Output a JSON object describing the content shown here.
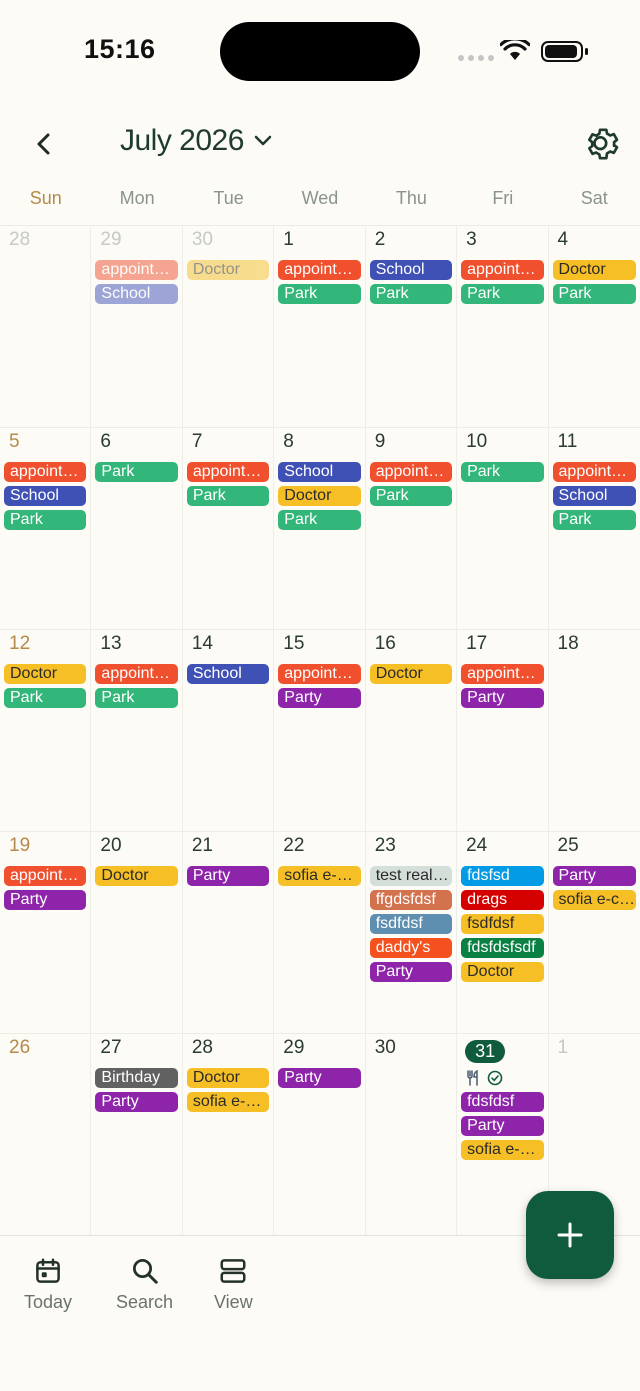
{
  "status_bar": {
    "time": "15:16"
  },
  "header": {
    "title": "July 2026"
  },
  "weekdays": [
    "Sun",
    "Mon",
    "Tue",
    "Wed",
    "Thu",
    "Fri",
    "Sat"
  ],
  "colors": {
    "appointment": "#f0502e",
    "school": "#3f51b5",
    "park": "#33b679",
    "doctor": "#f6bf26",
    "party": "#8e24aa",
    "birthday": "#616161",
    "test": "#d5dfd9",
    "ffgd": "#d2734e",
    "fsdf": "#5e8fb0",
    "daddy": "#f4511e",
    "fdsfsd": "#039be5",
    "drags": "#d50000",
    "fdsfsf": "#0b8043",
    "today": "#0f5b3b"
  },
  "weeks": [
    [
      {
        "day": "28",
        "out": true,
        "events": []
      },
      {
        "day": "29",
        "out": true,
        "events": [
          {
            "label": "appointment",
            "c": "appointment",
            "faded": true
          },
          {
            "label": "School",
            "c": "school",
            "faded": true
          }
        ]
      },
      {
        "day": "30",
        "out": true,
        "events": [
          {
            "label": "Doctor",
            "c": "doctor",
            "faded": true,
            "dark": true
          }
        ]
      },
      {
        "day": "1",
        "events": [
          {
            "label": "appointment",
            "c": "appointment"
          },
          {
            "label": "Park",
            "c": "park"
          }
        ]
      },
      {
        "day": "2",
        "events": [
          {
            "label": "School",
            "c": "school"
          },
          {
            "label": "Park",
            "c": "park"
          }
        ]
      },
      {
        "day": "3",
        "events": [
          {
            "label": "appointment",
            "c": "appointment"
          },
          {
            "label": "Park",
            "c": "park"
          }
        ]
      },
      {
        "day": "4",
        "events": [
          {
            "label": "Doctor",
            "c": "doctor",
            "dark": true
          },
          {
            "label": "Park",
            "c": "park"
          }
        ]
      }
    ],
    [
      {
        "day": "5",
        "sun": true,
        "events": [
          {
            "label": "appointment",
            "c": "appointment"
          },
          {
            "label": "School",
            "c": "school"
          },
          {
            "label": "Park",
            "c": "park"
          }
        ]
      },
      {
        "day": "6",
        "events": [
          {
            "label": "Park",
            "c": "park"
          }
        ]
      },
      {
        "day": "7",
        "events": [
          {
            "label": "appointment",
            "c": "appointment"
          },
          {
            "label": "Park",
            "c": "park"
          }
        ]
      },
      {
        "day": "8",
        "events": [
          {
            "label": "School",
            "c": "school"
          },
          {
            "label": "Doctor",
            "c": "doctor",
            "dark": true
          },
          {
            "label": "Park",
            "c": "park"
          }
        ]
      },
      {
        "day": "9",
        "events": [
          {
            "label": "appointment",
            "c": "appointment"
          },
          {
            "label": "Park",
            "c": "park"
          }
        ]
      },
      {
        "day": "10",
        "events": [
          {
            "label": "Park",
            "c": "park"
          }
        ]
      },
      {
        "day": "11",
        "events": [
          {
            "label": "appointment",
            "c": "appointment"
          },
          {
            "label": "School",
            "c": "school"
          },
          {
            "label": "Park",
            "c": "park"
          }
        ]
      }
    ],
    [
      {
        "day": "12",
        "sun": true,
        "events": [
          {
            "label": "Doctor",
            "c": "doctor",
            "dark": true
          },
          {
            "label": "Park",
            "c": "park"
          }
        ]
      },
      {
        "day": "13",
        "events": [
          {
            "label": "appointment",
            "c": "appointment"
          },
          {
            "label": "Park",
            "c": "park"
          }
        ]
      },
      {
        "day": "14",
        "events": [
          {
            "label": "School",
            "c": "school"
          }
        ]
      },
      {
        "day": "15",
        "events": [
          {
            "label": "appointment",
            "c": "appointment"
          },
          {
            "label": "Party",
            "c": "party"
          }
        ]
      },
      {
        "day": "16",
        "events": [
          {
            "label": "Doctor",
            "c": "doctor",
            "dark": true
          }
        ]
      },
      {
        "day": "17",
        "events": [
          {
            "label": "appointment",
            "c": "appointment"
          },
          {
            "label": "Party",
            "c": "party"
          }
        ]
      },
      {
        "day": "18",
        "events": []
      }
    ],
    [
      {
        "day": "19",
        "sun": true,
        "events": [
          {
            "label": "appointment",
            "c": "appointment"
          },
          {
            "label": "Party",
            "c": "party"
          }
        ]
      },
      {
        "day": "20",
        "events": [
          {
            "label": "Doctor",
            "c": "doctor",
            "dark": true
          }
        ]
      },
      {
        "day": "21",
        "events": [
          {
            "label": "Party",
            "c": "party"
          }
        ]
      },
      {
        "day": "22",
        "events": [
          {
            "label": "sofia e-commerce",
            "c": "doctor",
            "dark": true
          }
        ]
      },
      {
        "day": "23",
        "events": [
          {
            "label": "test reallyy",
            "c": "test",
            "dark": true
          },
          {
            "label": "ffgdsfdsf",
            "c": "ffgd"
          },
          {
            "label": "fsdfdsf",
            "c": "fsdf"
          },
          {
            "label": "daddy's",
            "c": "daddy"
          },
          {
            "label": "Party",
            "c": "party"
          }
        ]
      },
      {
        "day": "24",
        "events": [
          {
            "label": "fdsfsd",
            "c": "fdsfsd"
          },
          {
            "label": "drags",
            "c": "drags"
          },
          {
            "label": "fsdfdsf",
            "c": "doctor",
            "dark": true
          },
          {
            "label": "fdsfdsfsdf",
            "c": "fdsfsf"
          },
          {
            "label": "Doctor",
            "c": "doctor",
            "dark": true
          }
        ]
      },
      {
        "day": "25",
        "events": [
          {
            "label": "Party",
            "c": "party"
          },
          {
            "label": "sofia e-commerce",
            "c": "doctor",
            "dark": true
          }
        ]
      }
    ],
    [
      {
        "day": "26",
        "sun": true,
        "events": []
      },
      {
        "day": "27",
        "events": [
          {
            "label": "Birthday",
            "c": "birthday"
          },
          {
            "label": "Party",
            "c": "party"
          }
        ]
      },
      {
        "day": "28",
        "events": [
          {
            "label": "Doctor",
            "c": "doctor",
            "dark": true
          },
          {
            "label": "sofia e-commerce",
            "c": "doctor",
            "dark": true
          }
        ]
      },
      {
        "day": "29",
        "events": [
          {
            "label": "Party",
            "c": "party"
          }
        ]
      },
      {
        "day": "30",
        "events": []
      },
      {
        "day": "31",
        "today": true,
        "icons": [
          "restaurant-icon",
          "check-circle-icon"
        ],
        "events": [
          {
            "label": "fdsfdsf",
            "c": "party"
          },
          {
            "label": "Party",
            "c": "party"
          },
          {
            "label": "sofia e-commerce",
            "c": "doctor",
            "dark": true
          }
        ]
      },
      {
        "day": "1",
        "out": true,
        "events": []
      }
    ]
  ],
  "bottom_nav": [
    {
      "label": "Today",
      "icon": "calendar-today-icon"
    },
    {
      "label": "Search",
      "icon": "search-icon"
    },
    {
      "label": "View",
      "icon": "view-icon"
    }
  ],
  "fab": {
    "icon": "plus-icon"
  }
}
